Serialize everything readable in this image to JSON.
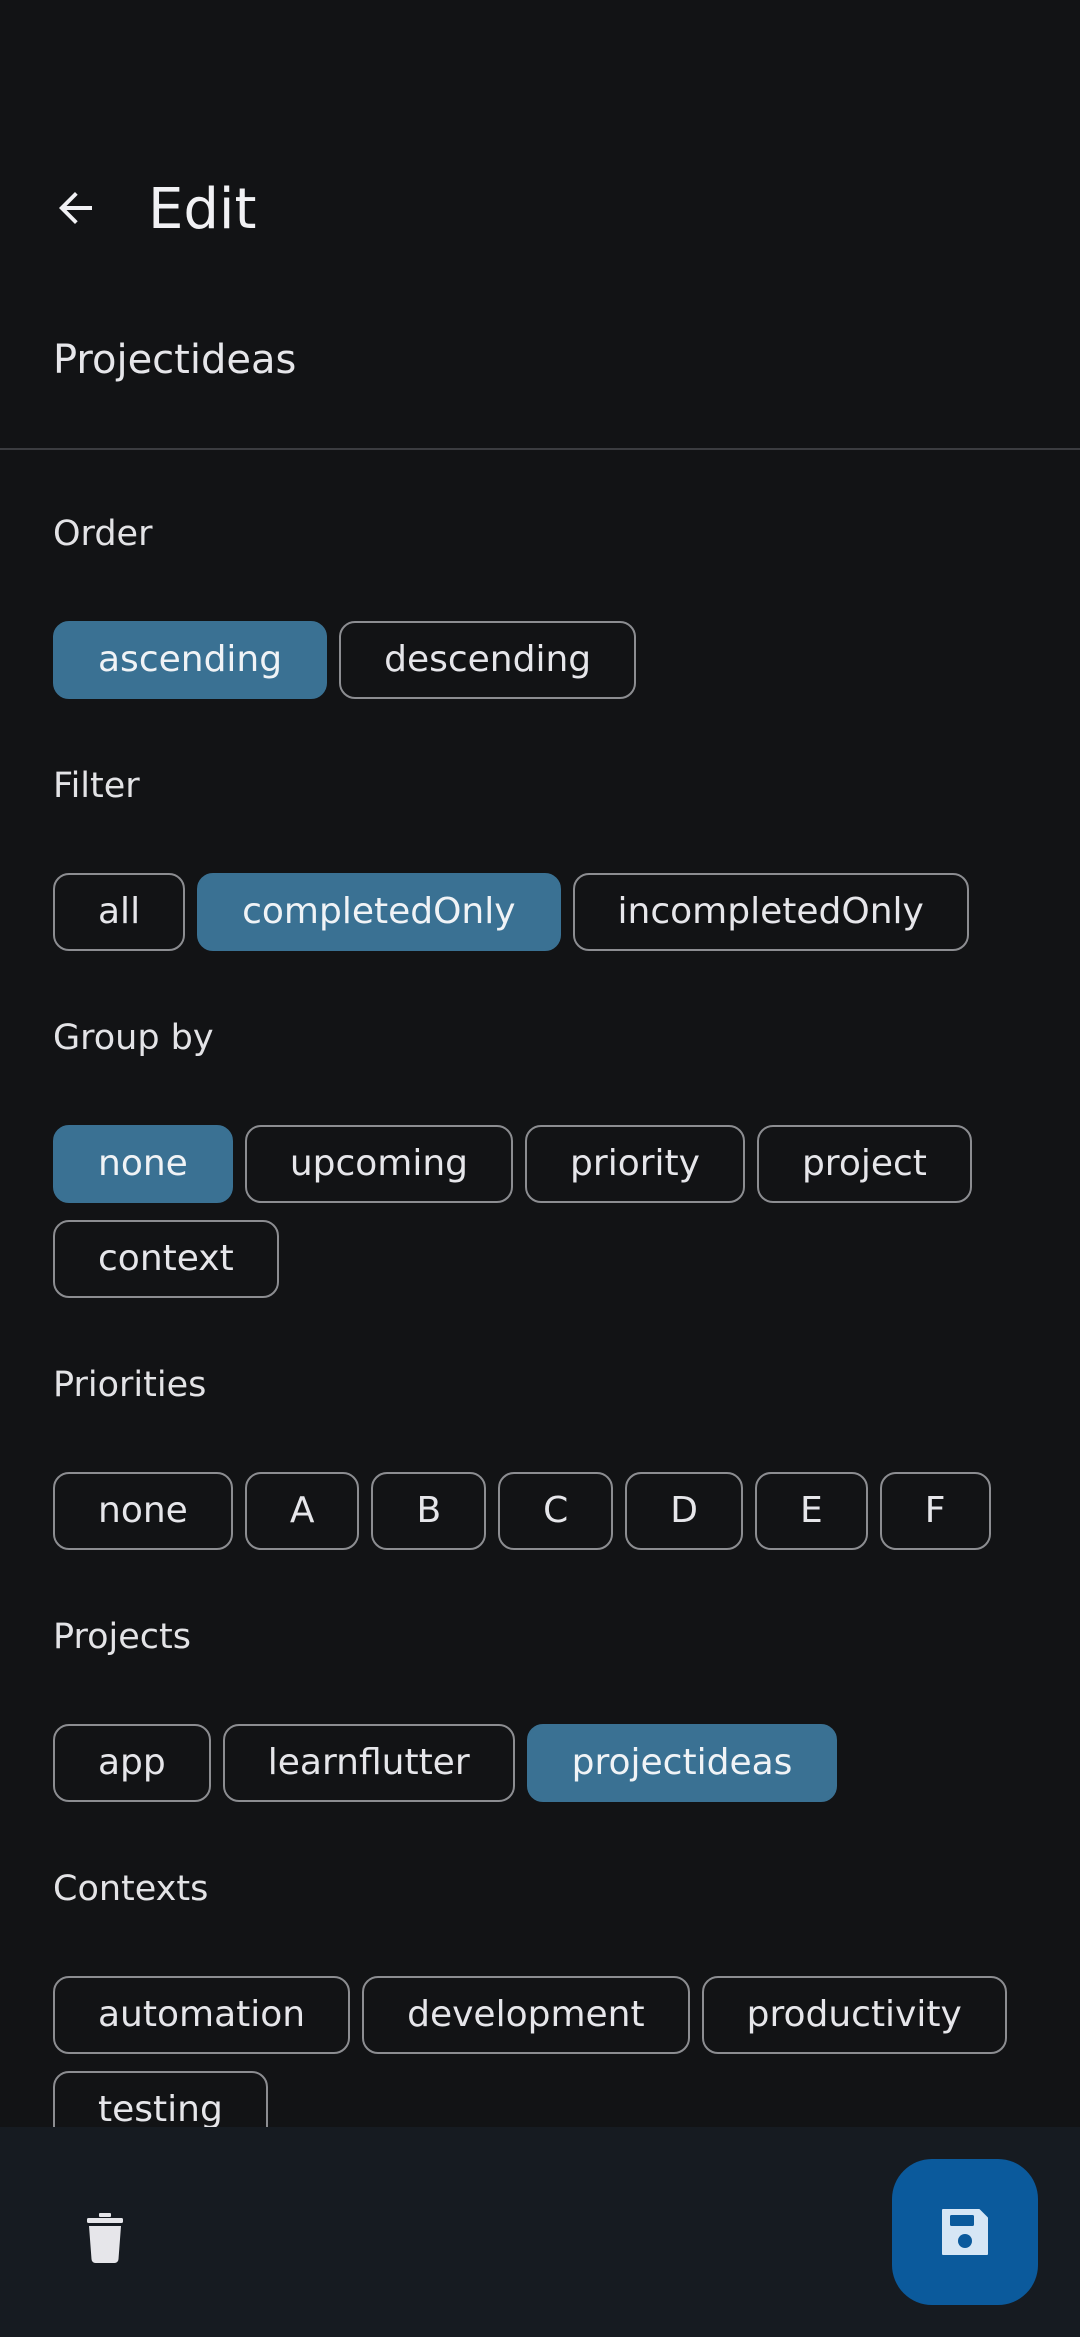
{
  "appbar": {
    "title": "Edit",
    "back_icon": "arrow-back-icon"
  },
  "list_name": "Projectideas",
  "sections": {
    "order": {
      "title": "Order",
      "chips": [
        "ascending",
        "descending"
      ],
      "selected": "ascending"
    },
    "filter": {
      "title": "Filter",
      "chips": [
        "all",
        "completedOnly",
        "incompletedOnly"
      ],
      "selected": "completedOnly"
    },
    "group_by": {
      "title": "Group by",
      "chips": [
        "none",
        "upcoming",
        "priority",
        "project",
        "context"
      ],
      "selected": "none"
    },
    "priorities": {
      "title": "Priorities",
      "chips": [
        "none",
        "A",
        "B",
        "C",
        "D",
        "E",
        "F"
      ],
      "selected": ""
    },
    "projects": {
      "title": "Projects",
      "chips": [
        "app",
        "learnflutter",
        "projectideas"
      ],
      "selected": "projectideas"
    },
    "contexts": {
      "title": "Contexts",
      "chips": [
        "automation",
        "development",
        "productivity",
        "testing"
      ],
      "selected": ""
    }
  },
  "bottom_bar": {
    "delete_icon": "trash-icon",
    "save_icon": "save-icon"
  },
  "colors": {
    "background": "#121315",
    "selected_chip": "#3a7193",
    "fab": "#0b5a9c",
    "bottom_bar": "#161b21"
  }
}
